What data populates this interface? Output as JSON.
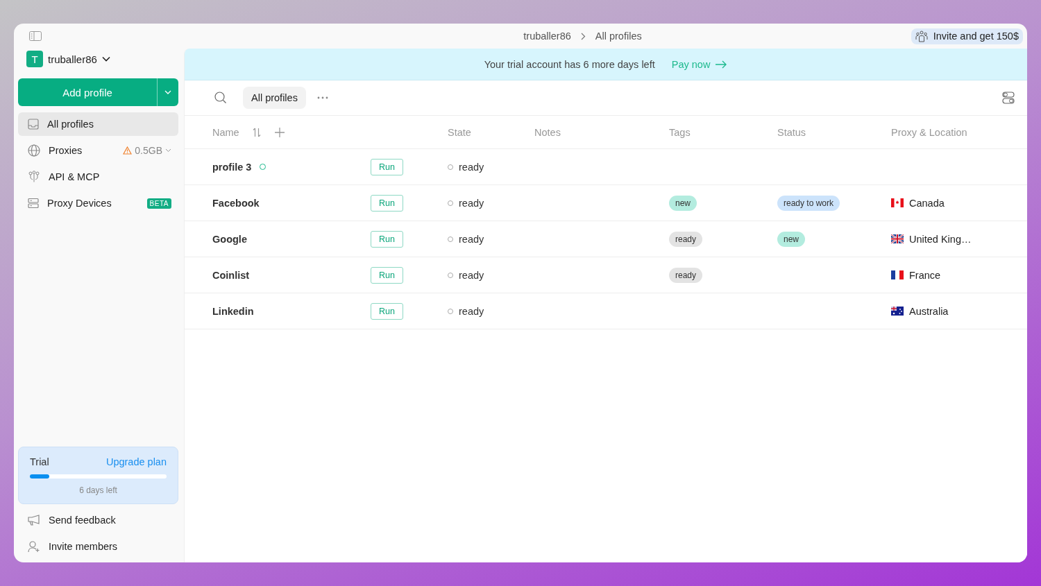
{
  "breadcrumb": [
    "truballer86",
    "All profiles"
  ],
  "invite": {
    "label": "Invite and get 150$"
  },
  "account": {
    "initial": "T",
    "name": "truballer86"
  },
  "add_button": {
    "label": "Add profile"
  },
  "sidebar": {
    "items": [
      {
        "label": "All profiles",
        "selected": true
      },
      {
        "label": "Proxies",
        "selected": false,
        "usage": "0.5GB"
      },
      {
        "label": "API & MCP",
        "selected": false
      },
      {
        "label": "Proxy Devices",
        "selected": false,
        "badge": "BETA"
      }
    ]
  },
  "trial": {
    "title": "Trial",
    "link": "Upgrade plan",
    "level": 0.14,
    "caption": "6 days left"
  },
  "footer_items": [
    "Send feedback",
    "Invite members"
  ],
  "banner": {
    "text": "Your trial account has 6 more days left",
    "link": "Pay now"
  },
  "toolbar": {
    "filter": "All profiles"
  },
  "table": {
    "columns": [
      "Name",
      "State",
      "Notes",
      "Tags",
      "Status",
      "Proxy & Location"
    ],
    "rows": [
      {
        "name": "profile 3",
        "indicator": true,
        "action": "Run",
        "state": "ready",
        "tags": [],
        "status": [],
        "location": ""
      },
      {
        "name": "Facebook",
        "indicator": false,
        "action": "Run",
        "state": "ready",
        "tags": [
          {
            "label": "new",
            "color": "#b3ecdf"
          }
        ],
        "status": [
          {
            "label": "ready to work",
            "color": "#cce3fb"
          }
        ],
        "location": "Canada"
      },
      {
        "name": "Google",
        "indicator": false,
        "action": "Run",
        "state": "ready",
        "tags": [
          {
            "label": "ready",
            "color": "#e3e3e3"
          }
        ],
        "status": [
          {
            "label": "new",
            "color": "#b3ecdf"
          }
        ],
        "location": "United King…"
      },
      {
        "name": "Coinlist",
        "indicator": false,
        "action": "Run",
        "state": "ready",
        "tags": [
          {
            "label": "ready",
            "color": "#e3e3e3"
          }
        ],
        "status": [],
        "location": "France"
      },
      {
        "name": "Linkedin",
        "indicator": false,
        "action": "Run",
        "state": "ready",
        "tags": [],
        "status": [],
        "location": "Australia"
      }
    ]
  }
}
